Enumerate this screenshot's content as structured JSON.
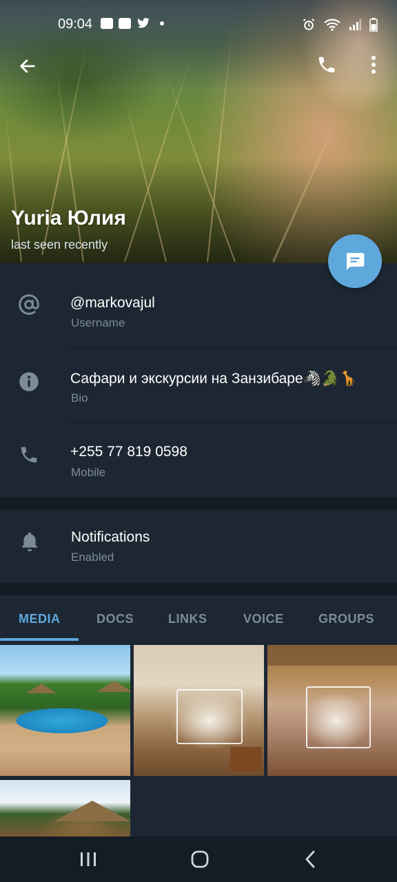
{
  "status_bar": {
    "time": "09:04"
  },
  "profile": {
    "name": "Yuria Юлия",
    "last_seen": "last seen recently"
  },
  "info": {
    "username": {
      "value": "@markovajul",
      "label": "Username"
    },
    "bio": {
      "value": "Сафари и экскурсии на Занзибаре🦓🐊🦒",
      "label": "Bio"
    },
    "phone": {
      "value": "+255 77 819 0598",
      "label": "Mobile"
    }
  },
  "notifications": {
    "title": "Notifications",
    "state": "Enabled"
  },
  "tabs": [
    {
      "label": "MEDIA",
      "active": true
    },
    {
      "label": "DOCS",
      "active": false
    },
    {
      "label": "LINKS",
      "active": false
    },
    {
      "label": "VOICE",
      "active": false
    },
    {
      "label": "GROUPS",
      "active": false
    }
  ],
  "colors": {
    "background": "#1d2733",
    "accent": "#5ea8dc",
    "secondary_text": "#7d8b99",
    "navbar": "#151c24"
  },
  "icons": {
    "back": "arrow-left-icon",
    "call": "phone-icon",
    "more": "more-vertical-icon",
    "message": "message-bubble-icon",
    "username": "at-sign-icon",
    "bio": "info-icon",
    "phone": "phone-icon",
    "notifications": "bell-icon"
  }
}
